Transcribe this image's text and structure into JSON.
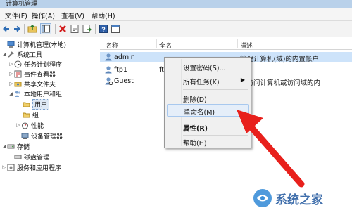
{
  "window": {
    "title": "计算机管理"
  },
  "menu": [
    "文件(F)",
    "操作(A)",
    "查看(V)",
    "帮助(H)"
  ],
  "tree": [
    {
      "label": "计算机管理(本地)",
      "icon": "computer-management-icon",
      "expander": ""
    },
    {
      "label": "系统工具",
      "icon": "system-tools-icon",
      "expander": "◢"
    },
    {
      "label": "任务计划程序",
      "icon": "clock-icon",
      "expander": "▷"
    },
    {
      "label": "事件查看器",
      "icon": "event-viewer-icon",
      "expander": "▷"
    },
    {
      "label": "共享文件夹",
      "icon": "shared-folder-icon",
      "expander": "▷"
    },
    {
      "label": "本地用户和组",
      "icon": "users-group-icon",
      "expander": "◢"
    },
    {
      "label": "用户",
      "icon": "folder-icon",
      "expander": ""
    },
    {
      "label": "组",
      "icon": "folder-icon",
      "expander": ""
    },
    {
      "label": "性能",
      "icon": "performance-icon",
      "expander": "▷"
    },
    {
      "label": "设备管理器",
      "icon": "device-manager-icon",
      "expander": ""
    },
    {
      "label": "存储",
      "icon": "storage-icon",
      "expander": "◢"
    },
    {
      "label": "磁盘管理",
      "icon": "disk-management-icon",
      "expander": ""
    },
    {
      "label": "服务和应用程序",
      "icon": "services-icon",
      "expander": "▷"
    }
  ],
  "columns": [
    "名称",
    "全名",
    "描述"
  ],
  "users": [
    {
      "name": "admin",
      "fullname": "",
      "description": "管理计算机(域)的内置帐户"
    },
    {
      "name": "ftp1",
      "fullname": "ft",
      "description": ""
    },
    {
      "name": "Guest",
      "fullname": "",
      "description": "宾访问计算机或访问域的内"
    }
  ],
  "context_menu": {
    "items": [
      {
        "label": "设置密码(S)...",
        "has_submenu": false,
        "bold": false
      },
      {
        "label": "所有任务(K)",
        "has_submenu": true,
        "bold": false
      },
      {
        "label": "删除(D)",
        "has_submenu": false,
        "bold": false
      },
      {
        "label": "重命名(M)",
        "has_submenu": false,
        "bold": false
      },
      {
        "label": "属性(R)",
        "has_submenu": false,
        "bold": true
      },
      {
        "label": "帮助(H)",
        "has_submenu": false,
        "bold": false
      }
    ],
    "highlighted": "重命名(M)"
  },
  "watermark": {
    "text": "系统之家"
  },
  "colors": {
    "selection": "#cde3fa",
    "arrow": "#e8201c",
    "titlebar": "#b9d1ea"
  }
}
